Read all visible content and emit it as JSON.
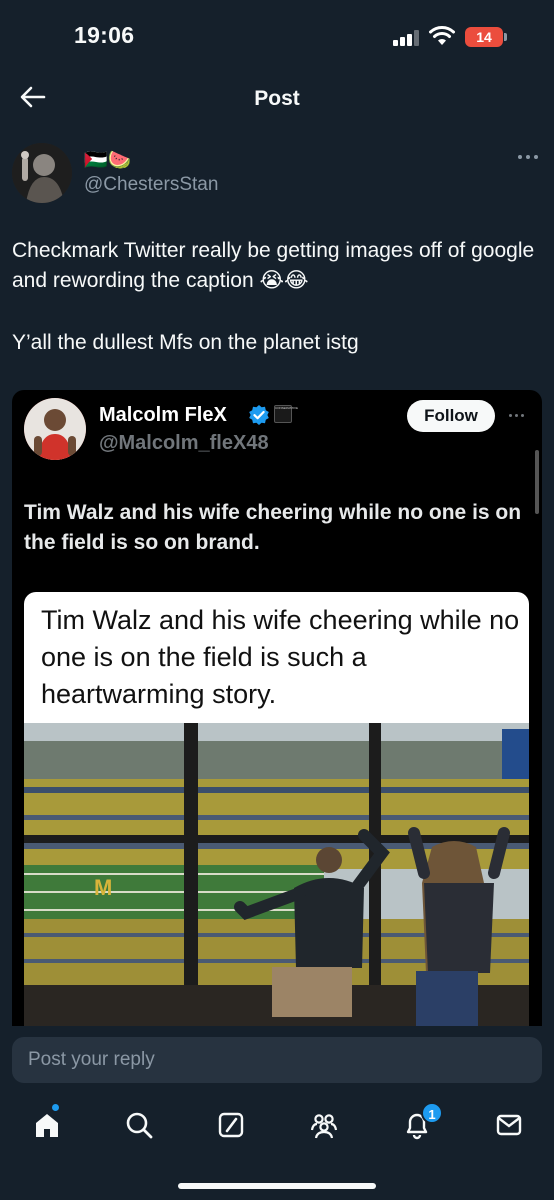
{
  "status_bar": {
    "time": "19:06",
    "battery_level": "14",
    "battery_color": "#eb4d3d"
  },
  "header": {
    "title": "Post",
    "back_icon": "arrow-left-icon"
  },
  "author": {
    "name_emojis": "🇵🇸🍉",
    "handle": "@ChestersStan"
  },
  "post": {
    "line1": "Checkmark Twitter really be getting images off of google and rewording the caption 😭😂",
    "line2": "Y’all the dullest Mfs on the planet istg"
  },
  "embedded": {
    "name": "Malcolm FleX",
    "handle": "@Malcolm_fleX48",
    "badge_text": "CONSERVATIVE",
    "follow_label": "Follow",
    "tweet_text": "Tim Walz and his wife cheering while no one is on the field is so on brand.",
    "quote_text": "Tim Walz and his wife cheering while no one is on the field is such a heartwarming story."
  },
  "reply": {
    "placeholder": "Post your reply"
  },
  "tabbar": {
    "items": [
      "home-icon",
      "search-icon",
      "grok-icon",
      "communities-icon",
      "bell-icon",
      "mail-icon"
    ],
    "notification_count": "1",
    "accent": "#1d9bf0"
  }
}
